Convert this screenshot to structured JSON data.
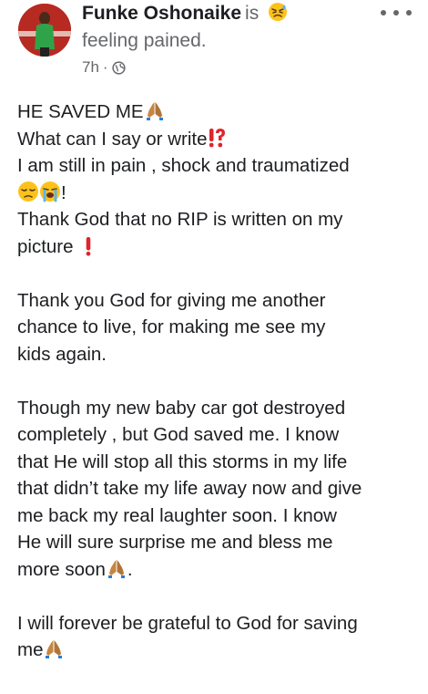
{
  "post": {
    "author": "Funke Oshonaike",
    "is_text": "is",
    "feeling": "feeling pained.",
    "time": "7h",
    "separator": "·",
    "privacy_icon": "globe-icon",
    "more_icon": "more-options-icon",
    "lines": {
      "l1": "HE SAVED ME",
      "l2": "What can I say or write",
      "l3": "I am still in pain , shock and traumatized",
      "l4": "!",
      "l5": "Thank God that no RIP is written on my",
      "l6": "picture ",
      "l7": "Thank you God for giving me another",
      "l8": "chance to live, for making me see my",
      "l9": "kids again.",
      "l10": "Though my new baby car got destroyed",
      "l11": "completely , but God saved me.  I know",
      "l12": "that He will stop all this storms in my life",
      "l13": "that didn’t take my life away now and give",
      "l14": "me back my real laughter soon. I know",
      "l15": "He will sure surprise me and bless me",
      "l16": "more soon",
      "l16b": ".",
      "l17": "I will forever be grateful to God for saving",
      "l18": "me"
    },
    "emojis": {
      "feeling": "pained-face-emoji",
      "praying": "folded-hands-emoji",
      "interrobang": "exclamation-question-emoji",
      "pensive": "pensive-face-emoji",
      "crying": "loudly-crying-face-emoji",
      "exclamation": "red-exclamation-emoji"
    },
    "colors": {
      "text": "#1c1e21",
      "secondary": "#65676b",
      "emoji_red": "#e0242c",
      "emoji_yellow": "#fcc21b"
    }
  }
}
